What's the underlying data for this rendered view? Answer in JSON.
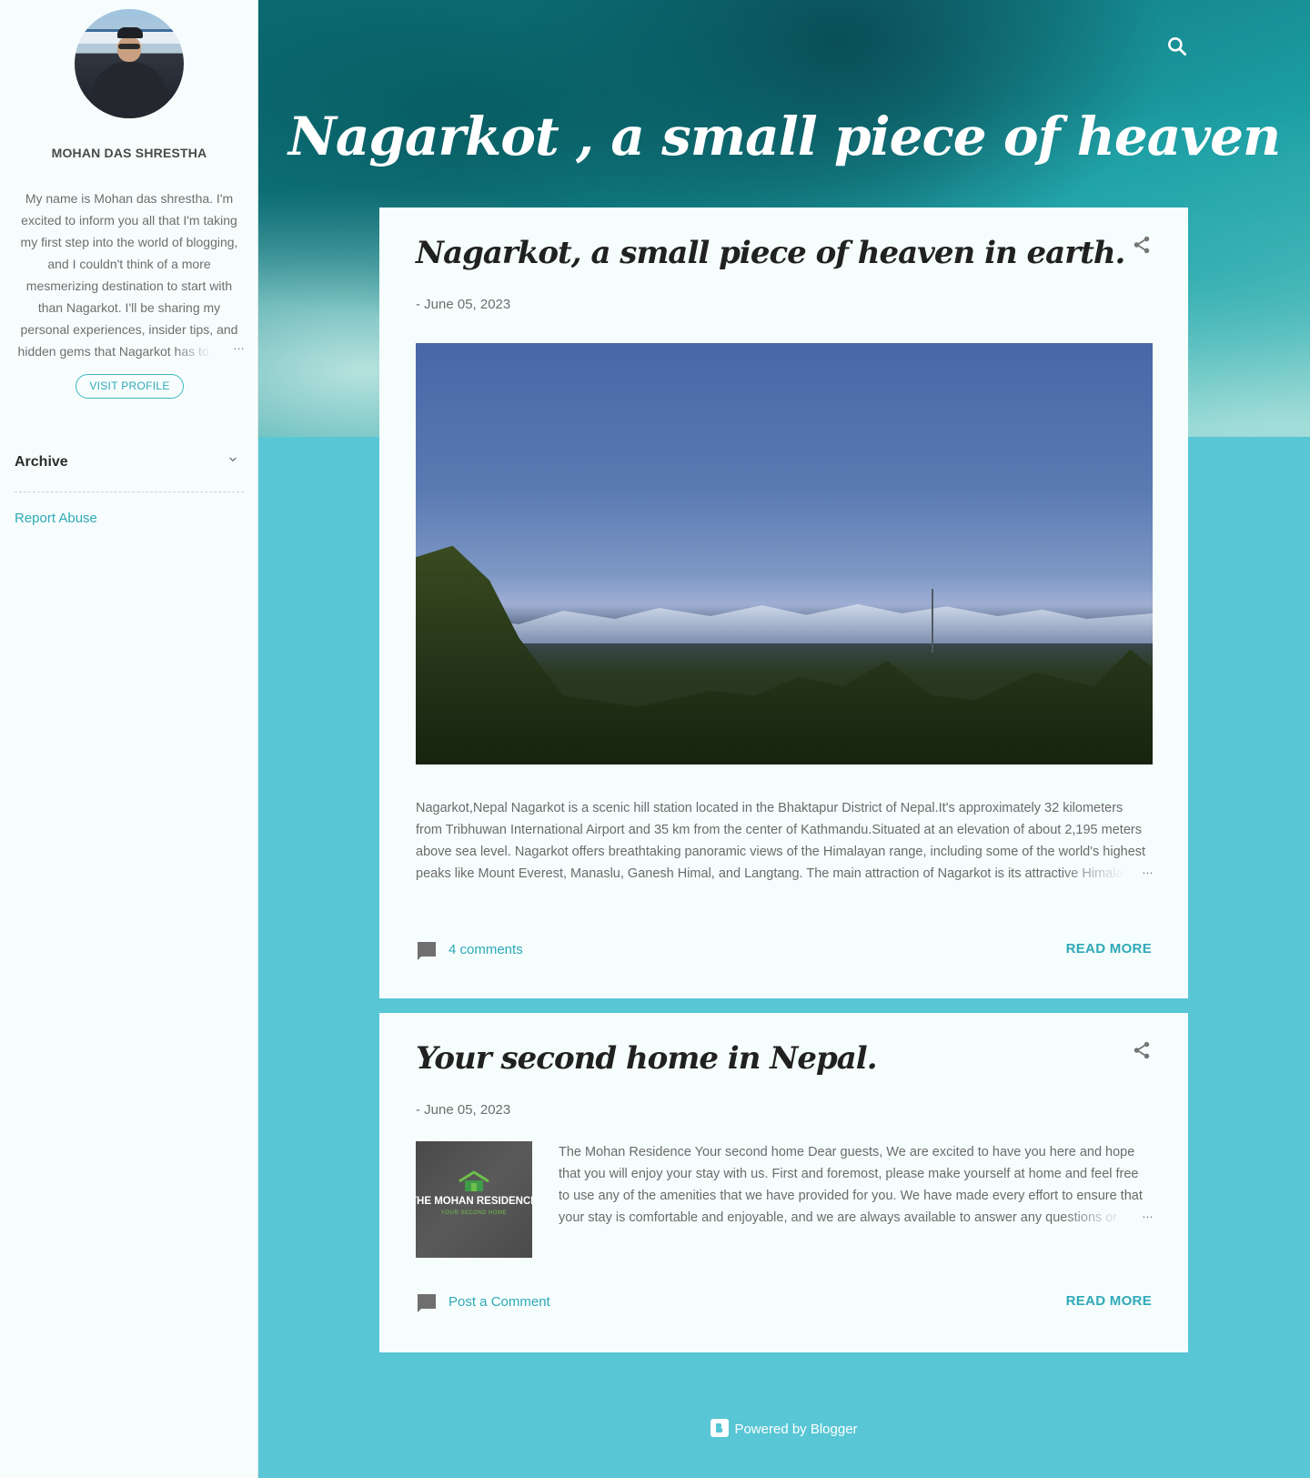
{
  "sidebar": {
    "author_name": "MOHAN DAS SHRESTHA",
    "bio": "My name is Mohan das shrestha. I'm excited to inform you all that I'm taking my first step into the world of blogging, and I couldn't think of a more mesmerizing destination to start with than Nagarkot. I'll be sharing my personal experiences, insider tips, and hidden gems that Nagarkot has to offer.",
    "bio_ellipsis": "…",
    "visit_profile": "VISIT PROFILE",
    "archive_label": "Archive",
    "report_abuse": "Report Abuse"
  },
  "header": {
    "blog_title": "Nagarkot , a small piece of heaven",
    "search_icon": "search-icon"
  },
  "posts": [
    {
      "title": "Nagarkot, a small piece of heaven in earth.",
      "date": "- June 05, 2023",
      "excerpt": "Nagarkot,Nepal Nagarkot is a scenic hill station located in the Bhaktapur District of Nepal.It's approximately 32 kilometers from Tribhuwan International Airport and 35 km from the center of  Kathmandu.Situated at an elevation of about 2,195 meters above sea level. Nagarkot offers breathtaking panoramic views of the Himalayan  range, including some of the world's highest peaks like Mount Everest, Manaslu, Ganesh Himal, and Langtang. The main attraction of Nagarkot is its attractive  Himalayan views. On a sunny and clear day, visitors are treated to mesmerizing  mountain views.",
      "ellipsis": "…",
      "comments": "4 comments",
      "read_more": "READ MORE"
    },
    {
      "title": "Your second home in Nepal.",
      "date": "- June 05, 2023",
      "excerpt": " The Mohan Residence  Your second home                 Dear guests, We are excited to have you here and hope that you will enjoy your stay with us. First and foremost, please make yourself at home and feel free to use any of the amenities that we have provided for you. We have made every effort to ensure that your stay is comfortable and enjoyable, and we are always available to answer any questions or concerns that you may have. Thank you for choosing us and have a nice stay.",
      "ellipsis": "…",
      "thumb_brand": "THE MOHAN RESIDENCE",
      "thumb_tag": "YOUR SECOND HOME",
      "comments": "Post a Comment",
      "read_more": "READ MORE"
    }
  ],
  "footer": {
    "powered_by": "Powered by Blogger"
  },
  "colors": {
    "accent": "#2fa9b8",
    "page_background": "#58c6d5",
    "card_background": "#f5fdfd",
    "sidebar_background": "#f7fdfd"
  }
}
